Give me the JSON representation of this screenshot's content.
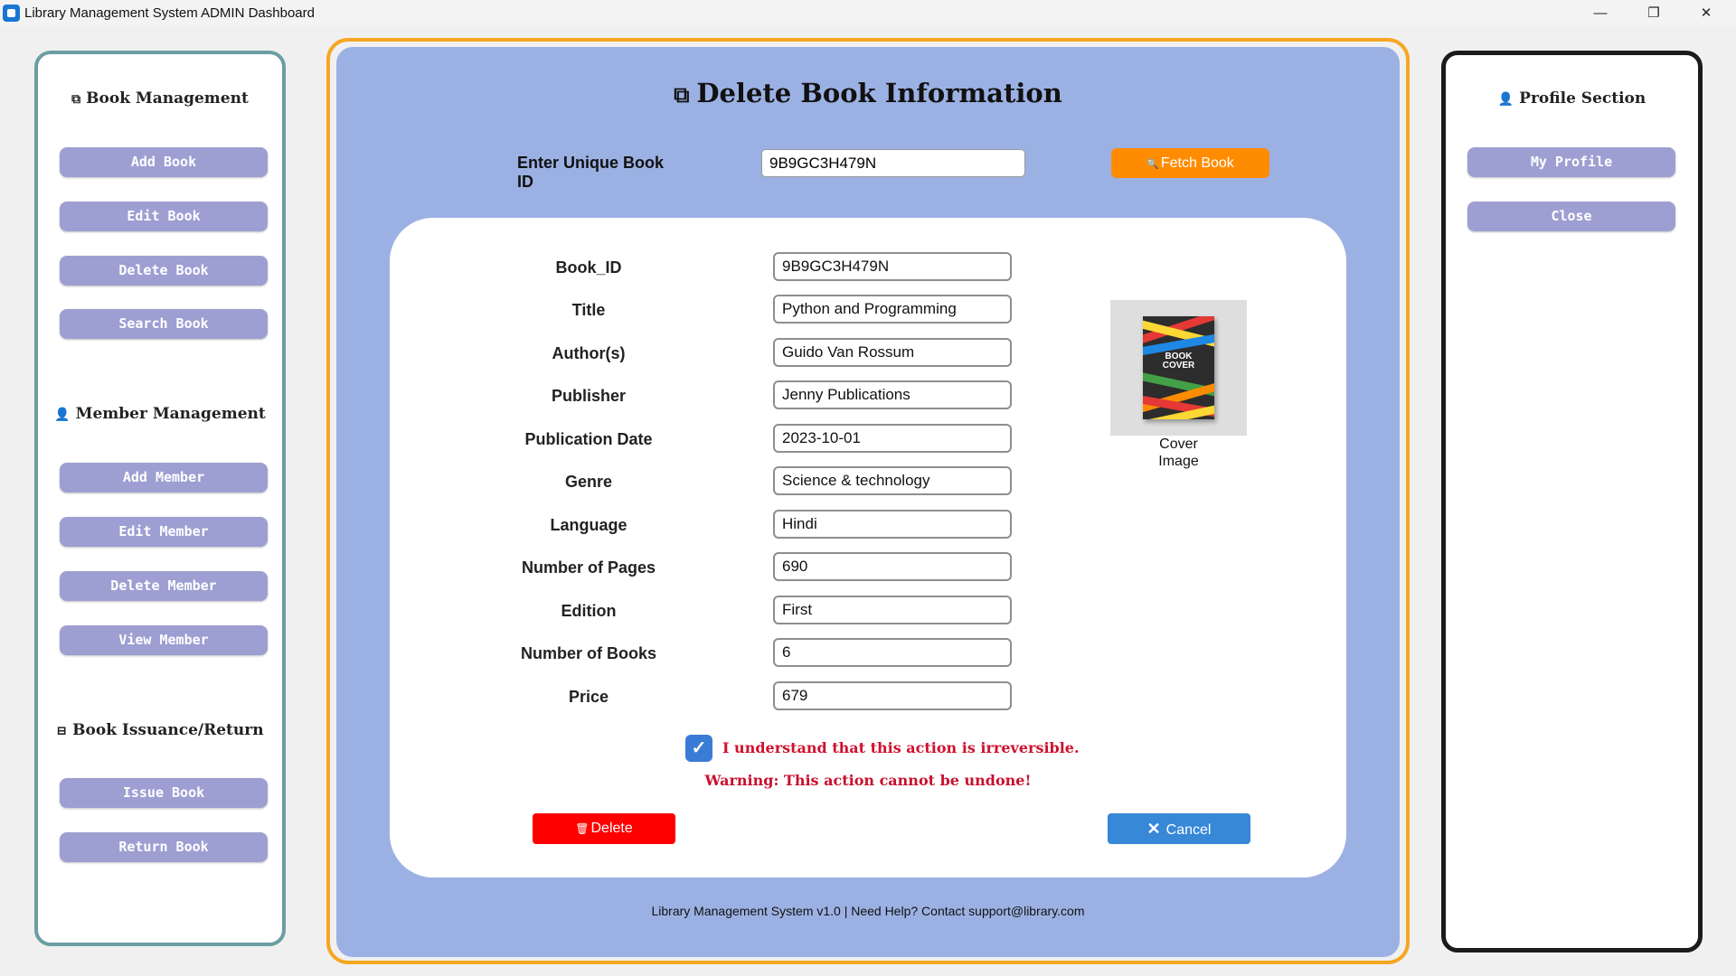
{
  "window": {
    "title": "Library Management System ADMIN Dashboard",
    "controls": {
      "minimize": "—",
      "maximize": "❐",
      "close": "✕"
    }
  },
  "sidebar_left": {
    "sections": [
      {
        "icon": "books-icon",
        "icon_glyph": "⧉",
        "title": "Book Management",
        "items": [
          "Add Book",
          "Edit Book",
          "Delete Book",
          "Search Book"
        ]
      },
      {
        "icon": "person-icon",
        "icon_glyph": "👤",
        "title": "Member Management",
        "items": [
          "Add Member",
          "Edit Member",
          "Delete Member",
          "View Member"
        ]
      },
      {
        "icon": "issue-icon",
        "icon_glyph": "⊟",
        "title": "Book Issuance/Return",
        "items": [
          "Issue Book",
          "Return Book"
        ]
      }
    ]
  },
  "sidebar_right": {
    "icon": "person-icon",
    "icon_glyph": "👤",
    "title": "Profile Section",
    "items": [
      "My Profile",
      "Close"
    ]
  },
  "main": {
    "title_icon": "⧉",
    "title": "Delete Book Information",
    "id_label": "Enter Unique Book ID",
    "id_value": "9B9GC3H479N",
    "fetch_icon": "🔍",
    "fetch_label": "Fetch Book",
    "fields": [
      {
        "label": "Book_ID",
        "value": "9B9GC3H479N"
      },
      {
        "label": "Title",
        "value": "Python and Programming"
      },
      {
        "label": "Author(s)",
        "value": "Guido Van Rossum"
      },
      {
        "label": "Publisher",
        "value": "Jenny Publications"
      },
      {
        "label": "Publication Date",
        "value": "2023-10-01"
      },
      {
        "label": "Genre",
        "value": "Science & technology"
      },
      {
        "label": "Language",
        "value": "Hindi"
      },
      {
        "label": "Number of Pages",
        "value": "690"
      },
      {
        "label": "Edition",
        "value": "First"
      },
      {
        "label": "Number of Books",
        "value": "6"
      },
      {
        "label": "Price",
        "value": "679"
      }
    ],
    "cover": {
      "book_text_line1": "BOOK",
      "book_text_line2": "COVER",
      "caption_line1": "Cover",
      "caption_line2": "Image"
    },
    "acknowledge_checked": true,
    "acknowledge_text": "I understand that this action is irreversible.",
    "warning": "Warning: This action cannot be undone!",
    "delete_icon": "🗑",
    "delete_label": "Delete",
    "cancel_icon": "✕",
    "cancel_label": "Cancel",
    "footer": "Library Management System v1.0 | Need Help? Contact support@library.com"
  },
  "colors": {
    "main_bg": "#9cb1e3",
    "sidebar_button": "#9d9fd2",
    "fetch_button": "#ff8c00",
    "delete_button": "#ff0000",
    "cancel_button": "#3888d8",
    "warning_text": "#c8102e",
    "frame_orange": "#f5a623"
  }
}
